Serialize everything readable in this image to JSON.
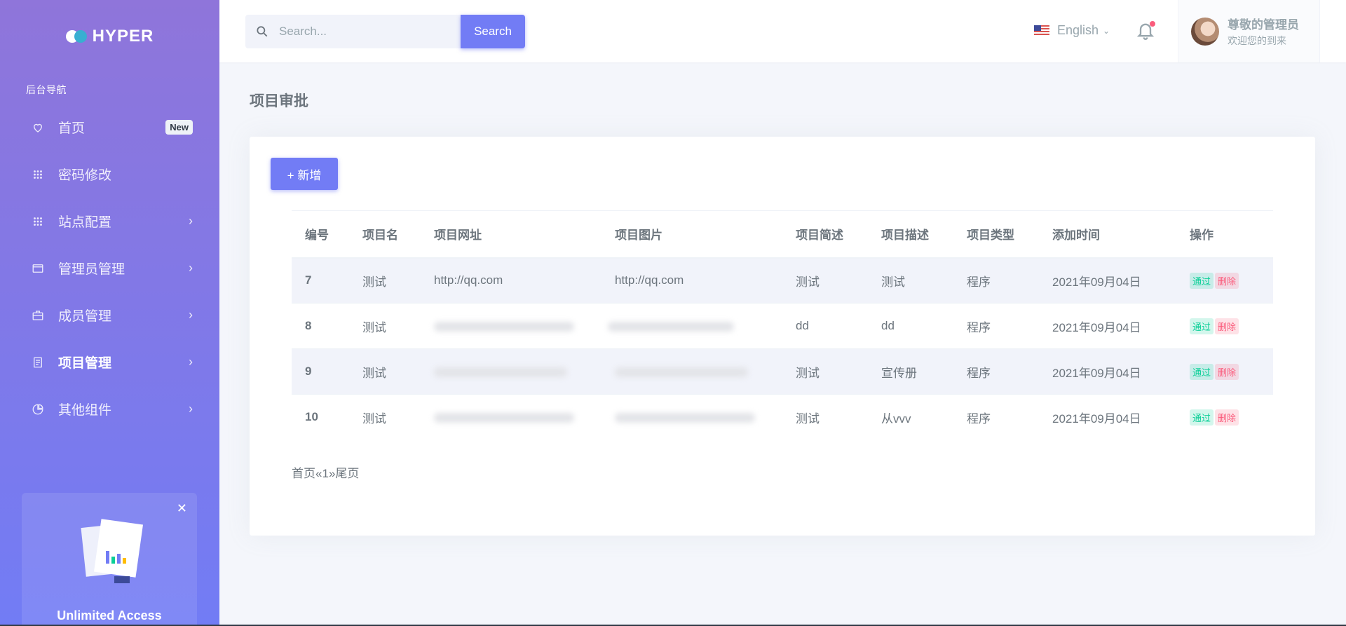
{
  "brand": {
    "name": "HYPER"
  },
  "sidebar": {
    "nav_title": "后台导航",
    "items": [
      {
        "label": "首页",
        "icon": "heart-icon",
        "badge": "New"
      },
      {
        "label": "密码修改",
        "icon": "grid-icon"
      },
      {
        "label": "站点配置",
        "icon": "grid-icon"
      },
      {
        "label": "管理员管理",
        "icon": "window-icon"
      },
      {
        "label": "成员管理",
        "icon": "briefcase-icon"
      },
      {
        "label": "项目管理",
        "icon": "document-icon"
      },
      {
        "label": "其他组件",
        "icon": "pie-icon"
      }
    ],
    "promo_title": "Unlimited Access"
  },
  "topbar": {
    "search_placeholder": "Search...",
    "search_button": "Search",
    "language": "English",
    "user_name": "尊敬的管理员",
    "user_sub": "欢迎您的到来"
  },
  "page": {
    "title": "项目审批",
    "add_button": "+ 新增"
  },
  "table": {
    "headers": [
      "编号",
      "项目名",
      "项目网址",
      "项目图片",
      "项目简述",
      "项目描述",
      "项目类型",
      "添加时间",
      "操作"
    ],
    "rows": [
      {
        "id": "7",
        "name": "测试",
        "url": "http://qq.com",
        "image": "http://qq.com",
        "brief": "测试",
        "desc": "测试",
        "type": "程序",
        "time": "2021年09月04日"
      },
      {
        "id": "8",
        "name": "测试",
        "url": "",
        "image": "",
        "brief": "dd",
        "desc": "dd",
        "type": "程序",
        "time": "2021年09月04日"
      },
      {
        "id": "9",
        "name": "测试",
        "url": "",
        "image": "",
        "brief": "测试",
        "desc": "宣传册",
        "type": "程序",
        "time": "2021年09月04日"
      },
      {
        "id": "10",
        "name": "测试",
        "url": "",
        "image": "",
        "brief": "测试",
        "desc": "从vvv",
        "type": "程序",
        "time": "2021年09月04日"
      }
    ],
    "approve_label": "通过",
    "delete_label": "删除"
  },
  "pagination": {
    "first": "首页",
    "prev": "«",
    "current": "1",
    "next": "»",
    "last": "尾页"
  }
}
